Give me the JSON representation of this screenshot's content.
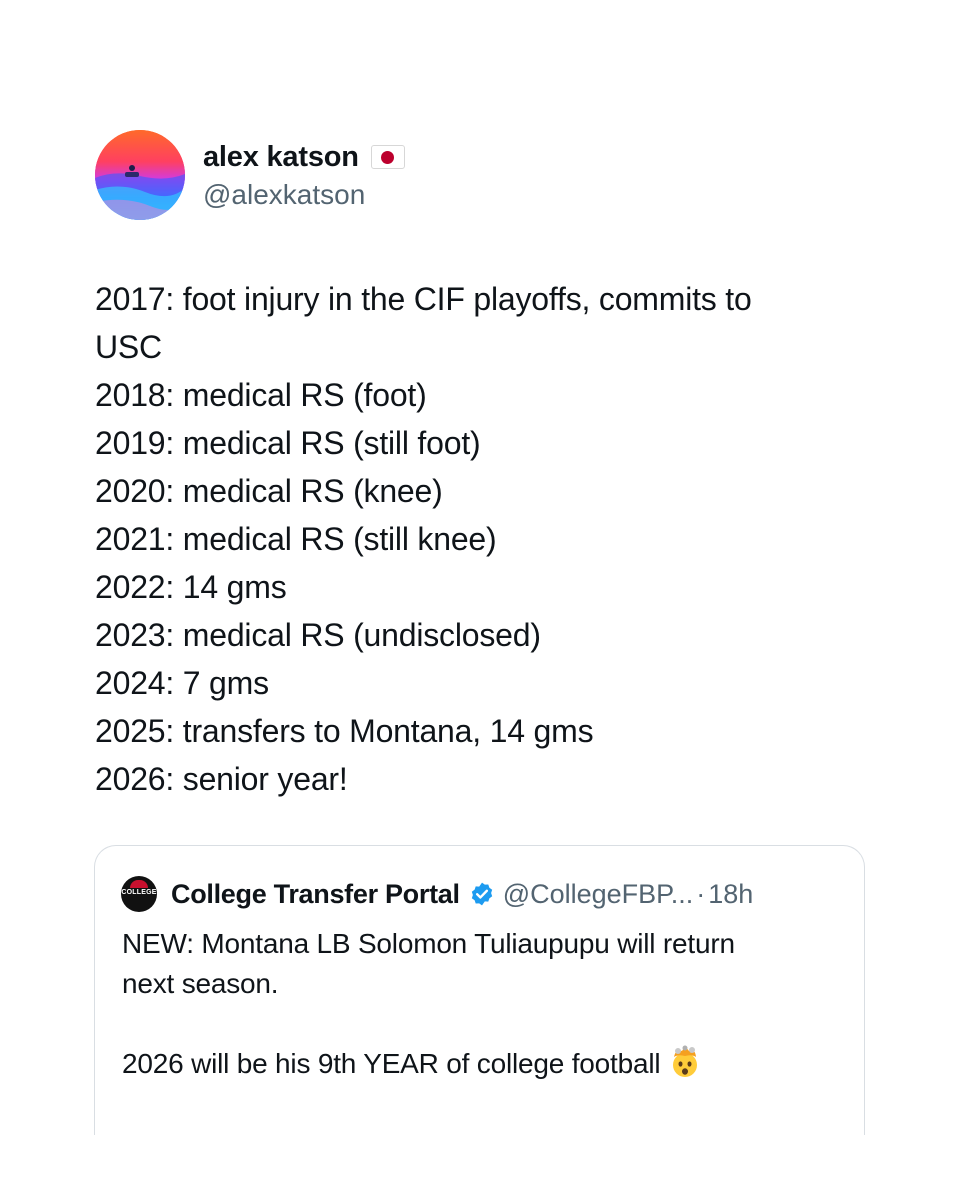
{
  "author": {
    "name": "alex katson",
    "handle": "@alexkatson",
    "flag_icon": "japan-flag-icon"
  },
  "tweet": {
    "lines": [
      "2017: foot injury in the CIF playoffs, commits to",
      "USC",
      "2018: medical RS (foot)",
      "2019: medical RS (still foot)",
      "2020: medical RS (knee)",
      "2021: medical RS (still knee)",
      "2022: 14 gms",
      "2023: medical RS (undisclosed)",
      "2024: 7 gms",
      "2025: transfers to Montana, 14 gms",
      "2026: senior year!"
    ]
  },
  "quote": {
    "name": "College Transfer Portal",
    "handle": "@CollegeFBP...",
    "separator": "·",
    "time": "18h",
    "avatar_text": "COLLEGE",
    "verified_icon": "verified-badge-icon",
    "lines": [
      "NEW: Montana LB Solomon Tuliaupupu will return",
      "next season.",
      "",
      "2026 will be his 9th YEAR of college football"
    ],
    "emoji_icon": "exploding-head-emoji-icon"
  },
  "colors": {
    "text": "#0f1419",
    "secondary": "#536471",
    "verified": "#1d9bf0",
    "border": "#d9dee3"
  }
}
